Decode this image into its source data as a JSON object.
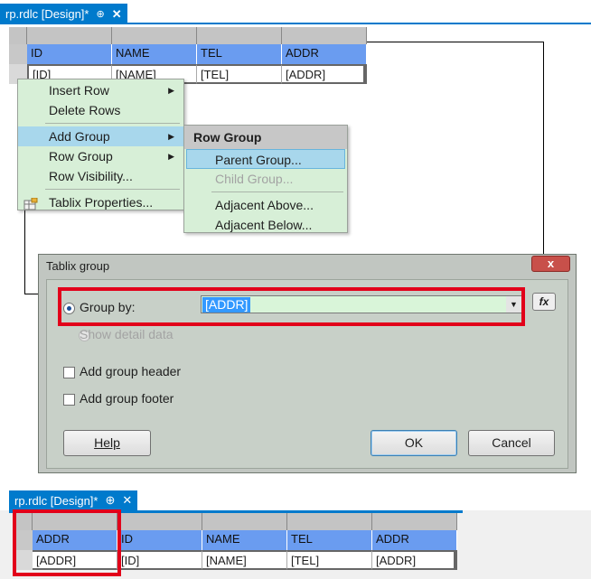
{
  "top_tab": {
    "title": "rp.rdlc [Design]*",
    "pin": "⊕",
    "close": "✕"
  },
  "table_top": {
    "headers": [
      "ID",
      "NAME",
      "TEL",
      "ADDR"
    ],
    "row": [
      "[ID]",
      "[NAME]",
      "[TEL]",
      "[ADDR]"
    ]
  },
  "context_menu": {
    "items": [
      {
        "label": "Insert Row",
        "submenu": true
      },
      {
        "label": "Delete Rows",
        "submenu": false
      },
      {
        "label": "Add Group",
        "submenu": true,
        "highlighted": true
      },
      {
        "label": "Row Group",
        "submenu": true
      },
      {
        "label": "Row Visibility...",
        "submenu": false
      },
      {
        "label": "Tablix Properties...",
        "submenu": false,
        "icon": "tablix-properties-icon"
      }
    ],
    "submenu": {
      "title": "Row Group",
      "items": [
        {
          "label": "Parent Group...",
          "state": "highlighted"
        },
        {
          "label": "Child Group...",
          "state": "disabled"
        },
        {
          "label": "Adjacent Above...",
          "state": "normal"
        },
        {
          "label": "Adjacent Below...",
          "state": "normal"
        }
      ]
    }
  },
  "dialog": {
    "title": "Tablix group",
    "close_label": "x",
    "group_by_label": "Group by:",
    "group_by_value": "[ADDR]",
    "fx_label": "fx",
    "detail_label": "Show detail data",
    "add_header_label": "Add group header",
    "add_footer_label": "Add group footer",
    "help_label": "Help",
    "ok_label": "OK",
    "cancel_label": "Cancel"
  },
  "bottom_tab": {
    "title": "rp.rdlc [Design]*",
    "pin": "⊕",
    "close": "✕"
  },
  "table_bottom": {
    "headers": [
      "ADDR",
      "ID",
      "NAME",
      "TEL",
      "ADDR"
    ],
    "row": [
      "[ADDR]",
      "[ID]",
      "[NAME]",
      "[TEL]",
      "[ADDR]"
    ]
  },
  "colors": {
    "accent": "#007acc",
    "header_blue": "#6a9cf0",
    "menu_bg": "#d7efd7",
    "highlight": "#a8d7ec",
    "annotation_red": "#e2001a"
  }
}
